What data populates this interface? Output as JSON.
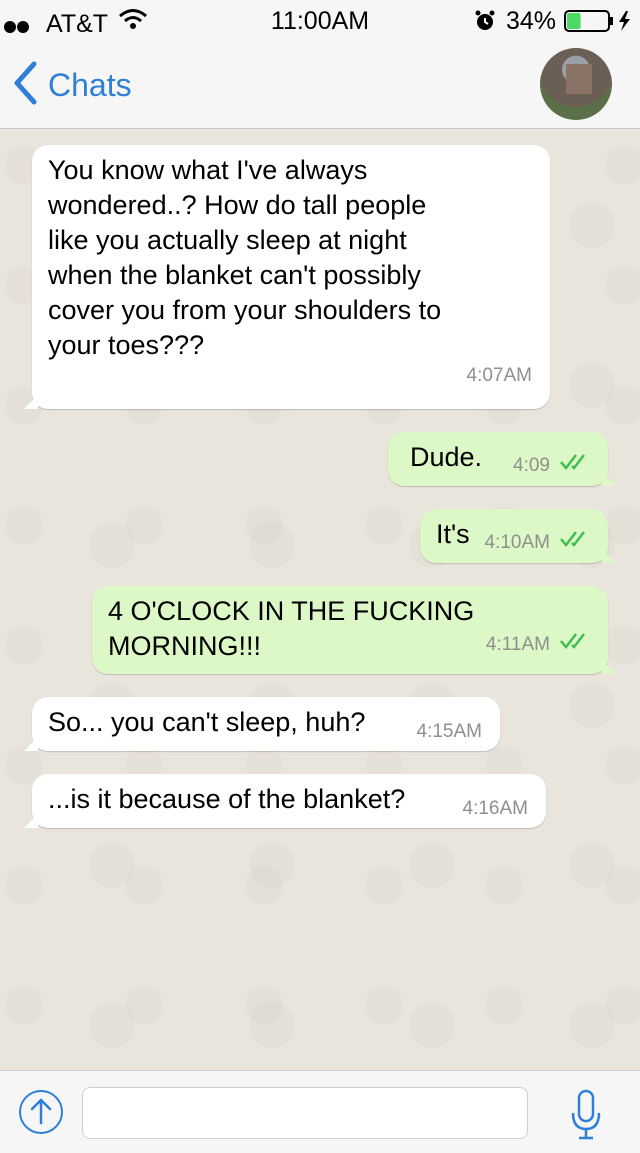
{
  "status_bar": {
    "carrier": "AT&T",
    "time": "11:00AM",
    "battery_percent": "34%",
    "battery_level": 0.34
  },
  "nav": {
    "back_label": "Chats"
  },
  "colors": {
    "accent": "#2f7fd8",
    "incoming_bubble": "#ffffff",
    "outgoing_bubble": "#dcf8c6",
    "read_tick": "#3fbf4f",
    "battery": "#4cd964"
  },
  "messages": [
    {
      "direction": "incoming",
      "text": "You know what I've always wondered..? How do tall people like you actually sleep at night when the blanket can't possibly cover you from your shoulders to your toes???",
      "time": "4:07AM"
    },
    {
      "direction": "outgoing",
      "text": "Dude.",
      "time": "4:09",
      "status": "read"
    },
    {
      "direction": "outgoing",
      "text": "It's",
      "time": "4:10AM",
      "status": "read"
    },
    {
      "direction": "outgoing",
      "text": "4 O'CLOCK IN THE FUCKING MORNING!!!",
      "time": "4:11AM",
      "status": "read"
    },
    {
      "direction": "incoming",
      "text": "So... you can't sleep, huh?",
      "time": "4:15AM"
    },
    {
      "direction": "incoming",
      "text": "...is it because of the blanket?",
      "time": "4:16AM"
    }
  ],
  "input": {
    "placeholder": "",
    "value": ""
  },
  "icons": {
    "back": "chevron-left-icon",
    "attach": "upload-arrow-icon",
    "mic": "microphone-icon",
    "read": "double-check-icon"
  }
}
